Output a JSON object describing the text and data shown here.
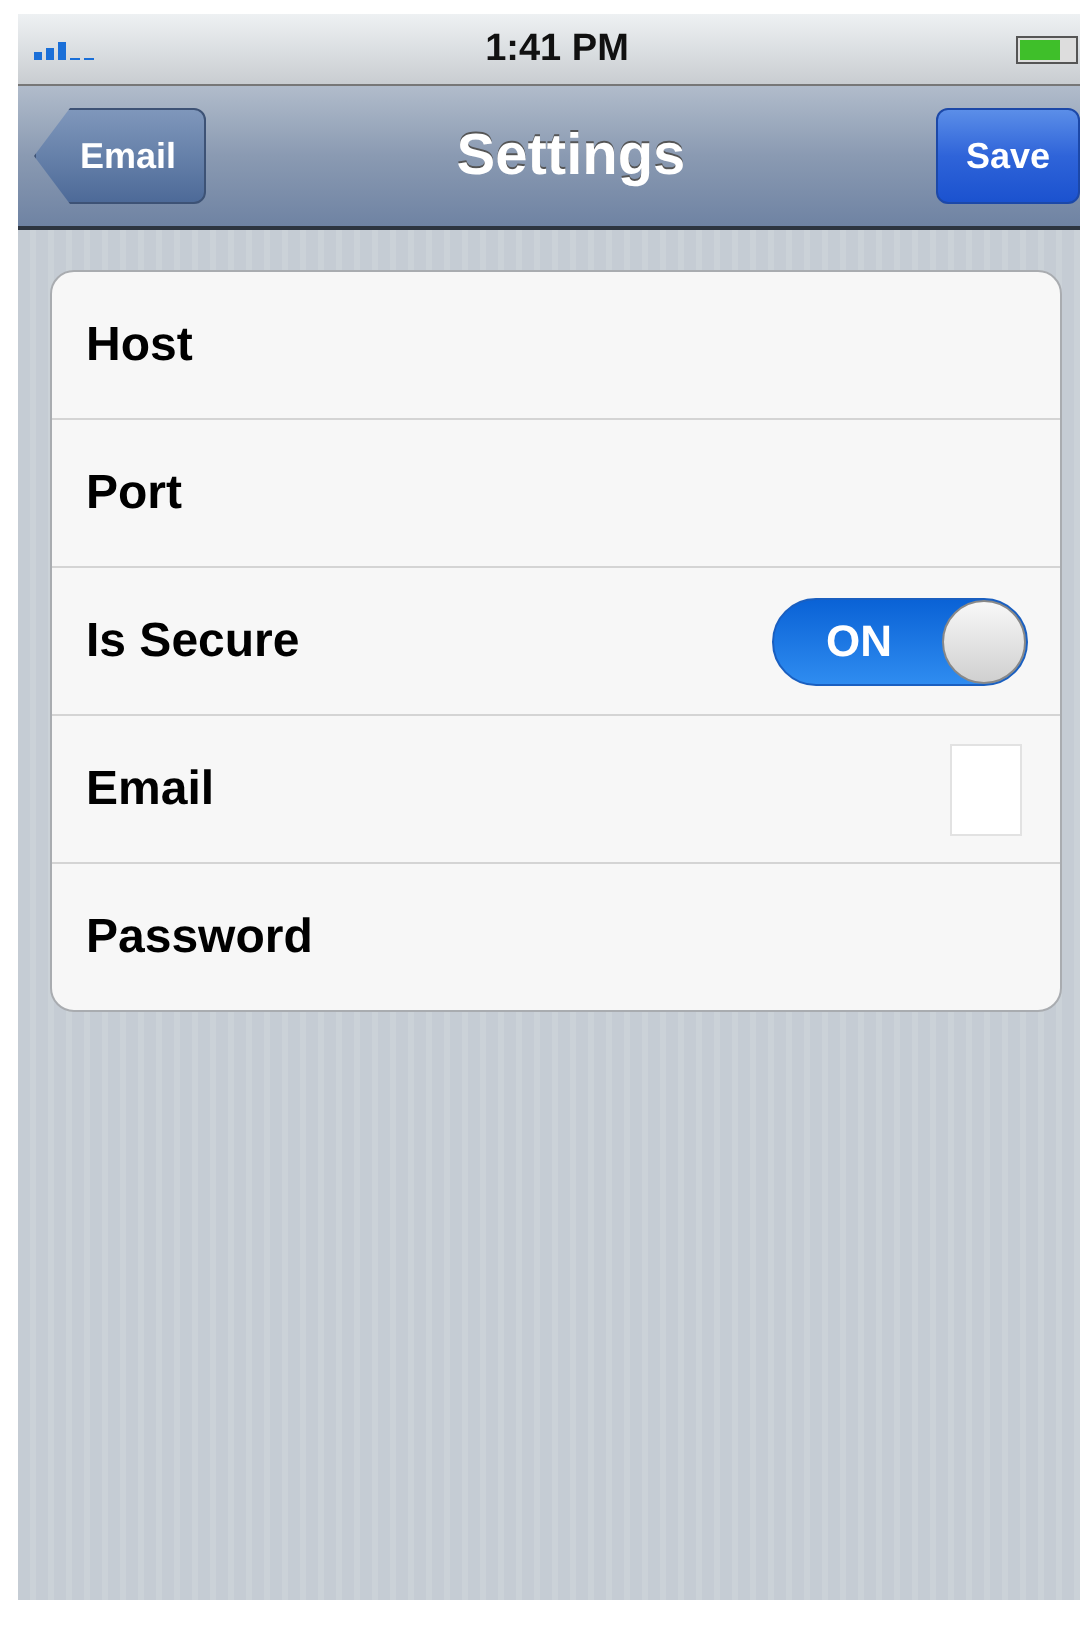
{
  "status_bar": {
    "time": "1:41 PM"
  },
  "nav_bar": {
    "back": "Email",
    "title": "Settings",
    "action": "Save"
  },
  "rows": [
    {
      "label": "Host",
      "kind": "plain"
    },
    {
      "label": "Port",
      "kind": "plain"
    },
    {
      "label": "Is Secure",
      "kind": "toggle",
      "on": true,
      "switch_label": "ON"
    },
    {
      "label": "Email",
      "kind": "field"
    },
    {
      "label": "Password",
      "kind": "plain"
    }
  ]
}
